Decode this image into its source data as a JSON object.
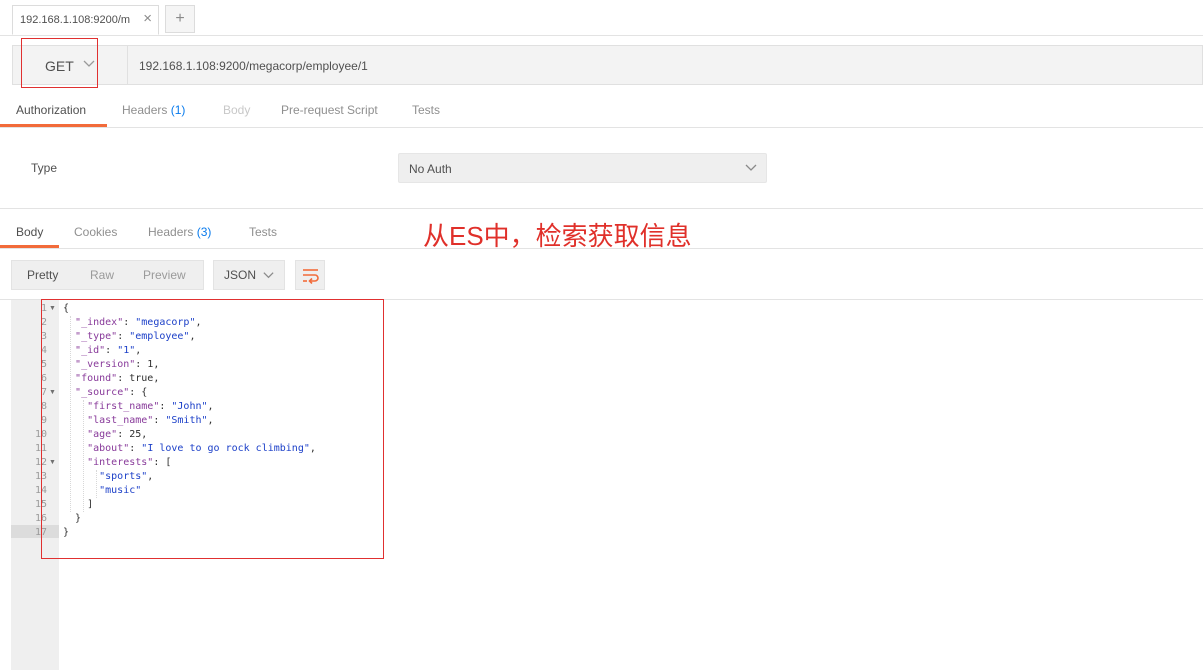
{
  "tabs": {
    "request_tab_title": "192.168.1.108:9200/m",
    "close_glyph": "×",
    "new_tab_glyph": "+"
  },
  "request": {
    "method": "GET",
    "url": "192.168.1.108:9200/megacorp/employee/1"
  },
  "request_tabs": [
    {
      "label": "Authorization",
      "count": "",
      "state": "active"
    },
    {
      "label": "Headers",
      "count": "(1)",
      "state": "normal"
    },
    {
      "label": "Body",
      "count": "",
      "state": "disabled"
    },
    {
      "label": "Pre-request Script",
      "count": "",
      "state": "normal"
    },
    {
      "label": "Tests",
      "count": "",
      "state": "normal"
    }
  ],
  "auth": {
    "type_label": "Type",
    "value": "No Auth"
  },
  "response_tabs": [
    {
      "label": "Body",
      "count": "",
      "state": "active"
    },
    {
      "label": "Cookies",
      "count": "",
      "state": "normal"
    },
    {
      "label": "Headers",
      "count": "(3)",
      "state": "normal"
    },
    {
      "label": "Tests",
      "count": "",
      "state": "normal"
    }
  ],
  "annotation": "从ES中，检索获取信息",
  "view_modes": [
    "Pretty",
    "Raw",
    "Preview"
  ],
  "active_view_mode": "Pretty",
  "format": "JSON",
  "icons": {
    "method_dropdown": "chevron-down-icon",
    "auth_dropdown": "chevron-down-icon",
    "format_dropdown": "chevron-down-icon",
    "wrap": "wrap-lines-icon",
    "fold": "fold-arrow-icon"
  },
  "colors": {
    "accent": "#f26b3a",
    "annotation_red": "#e0302a",
    "count_blue": "#097bed",
    "json_key": "#883a9a",
    "json_string": "#1b3fc8"
  },
  "code_lines": [
    {
      "n": "1",
      "fold": true,
      "parts": [
        [
          "p",
          "{"
        ]
      ]
    },
    {
      "n": "2",
      "fold": false,
      "parts": [
        [
          "p",
          "  "
        ],
        [
          "k",
          "\"_index\""
        ],
        [
          "p",
          ": "
        ],
        [
          "s",
          "\"megacorp\""
        ],
        [
          "p",
          ","
        ]
      ]
    },
    {
      "n": "3",
      "fold": false,
      "parts": [
        [
          "p",
          "  "
        ],
        [
          "k",
          "\"_type\""
        ],
        [
          "p",
          ": "
        ],
        [
          "s",
          "\"employee\""
        ],
        [
          "p",
          ","
        ]
      ]
    },
    {
      "n": "4",
      "fold": false,
      "parts": [
        [
          "p",
          "  "
        ],
        [
          "k",
          "\"_id\""
        ],
        [
          "p",
          ": "
        ],
        [
          "s",
          "\"1\""
        ],
        [
          "p",
          ","
        ]
      ]
    },
    {
      "n": "5",
      "fold": false,
      "parts": [
        [
          "p",
          "  "
        ],
        [
          "k",
          "\"_version\""
        ],
        [
          "p",
          ": 1,"
        ]
      ]
    },
    {
      "n": "6",
      "fold": false,
      "parts": [
        [
          "p",
          "  "
        ],
        [
          "k",
          "\"found\""
        ],
        [
          "p",
          ": true,"
        ]
      ]
    },
    {
      "n": "7",
      "fold": true,
      "parts": [
        [
          "p",
          "  "
        ],
        [
          "k",
          "\"_source\""
        ],
        [
          "p",
          ": {"
        ]
      ]
    },
    {
      "n": "8",
      "fold": false,
      "parts": [
        [
          "p",
          "    "
        ],
        [
          "k",
          "\"first_name\""
        ],
        [
          "p",
          ": "
        ],
        [
          "s",
          "\"John\""
        ],
        [
          "p",
          ","
        ]
      ]
    },
    {
      "n": "9",
      "fold": false,
      "parts": [
        [
          "p",
          "    "
        ],
        [
          "k",
          "\"last_name\""
        ],
        [
          "p",
          ": "
        ],
        [
          "s",
          "\"Smith\""
        ],
        [
          "p",
          ","
        ]
      ]
    },
    {
      "n": "10",
      "fold": false,
      "parts": [
        [
          "p",
          "    "
        ],
        [
          "k",
          "\"age\""
        ],
        [
          "p",
          ": 25,"
        ]
      ]
    },
    {
      "n": "11",
      "fold": false,
      "parts": [
        [
          "p",
          "    "
        ],
        [
          "k",
          "\"about\""
        ],
        [
          "p",
          ": "
        ],
        [
          "s",
          "\"I love to go rock climbing\""
        ],
        [
          "p",
          ","
        ]
      ]
    },
    {
      "n": "12",
      "fold": true,
      "parts": [
        [
          "p",
          "    "
        ],
        [
          "k",
          "\"interests\""
        ],
        [
          "p",
          ": ["
        ]
      ]
    },
    {
      "n": "13",
      "fold": false,
      "parts": [
        [
          "p",
          "      "
        ],
        [
          "s",
          "\"sports\""
        ],
        [
          "p",
          ","
        ]
      ]
    },
    {
      "n": "14",
      "fold": false,
      "parts": [
        [
          "p",
          "      "
        ],
        [
          "s",
          "\"music\""
        ]
      ]
    },
    {
      "n": "15",
      "fold": false,
      "parts": [
        [
          "p",
          "    ]"
        ]
      ]
    },
    {
      "n": "16",
      "fold": false,
      "parts": [
        [
          "p",
          "  }"
        ]
      ]
    },
    {
      "n": "17",
      "fold": false,
      "parts": [
        [
          "p",
          "}"
        ]
      ]
    }
  ]
}
